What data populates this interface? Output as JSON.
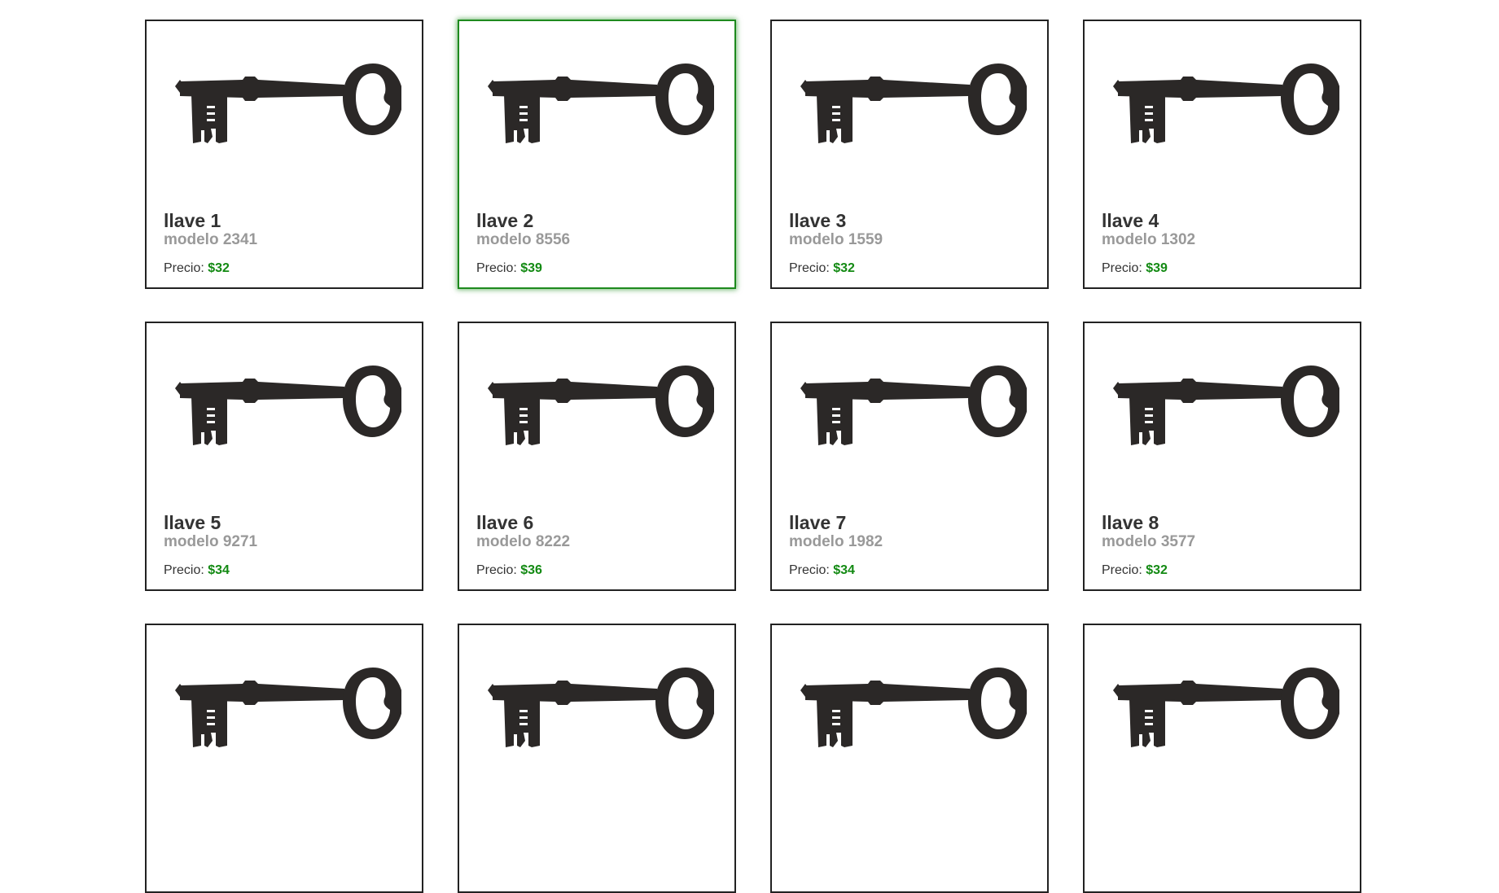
{
  "colors": {
    "accent": "#138a13",
    "selected_border": "#1e8a1e",
    "card_border": "#222222",
    "model_text": "#999999"
  },
  "products": [
    {
      "name": "llave 1",
      "model": "modelo 2341",
      "price_label": "Precio:",
      "price": "$32",
      "image_icon": "key-icon",
      "selected": false
    },
    {
      "name": "llave 2",
      "model": "modelo 8556",
      "price_label": "Precio:",
      "price": "$39",
      "image_icon": "key-icon",
      "selected": true
    },
    {
      "name": "llave 3",
      "model": "modelo 1559",
      "price_label": "Precio:",
      "price": "$32",
      "image_icon": "key-icon",
      "selected": false
    },
    {
      "name": "llave 4",
      "model": "modelo 1302",
      "price_label": "Precio:",
      "price": "$39",
      "image_icon": "key-icon",
      "selected": false
    },
    {
      "name": "llave 5",
      "model": "modelo 9271",
      "price_label": "Precio:",
      "price": "$34",
      "image_icon": "key-icon",
      "selected": false
    },
    {
      "name": "llave 6",
      "model": "modelo 8222",
      "price_label": "Precio:",
      "price": "$36",
      "image_icon": "key-icon",
      "selected": false
    },
    {
      "name": "llave 7",
      "model": "modelo 1982",
      "price_label": "Precio:",
      "price": "$34",
      "image_icon": "key-icon",
      "selected": false
    },
    {
      "name": "llave 8",
      "model": "modelo 3577",
      "price_label": "Precio:",
      "price": "$32",
      "image_icon": "key-icon",
      "selected": false
    },
    {
      "name": "",
      "model": "",
      "price_label": "",
      "price": "",
      "image_icon": "key-icon",
      "selected": false
    },
    {
      "name": "",
      "model": "",
      "price_label": "",
      "price": "",
      "image_icon": "key-icon",
      "selected": false
    },
    {
      "name": "",
      "model": "",
      "price_label": "",
      "price": "",
      "image_icon": "key-icon",
      "selected": false
    },
    {
      "name": "",
      "model": "",
      "price_label": "",
      "price": "",
      "image_icon": "key-icon",
      "selected": false
    }
  ]
}
